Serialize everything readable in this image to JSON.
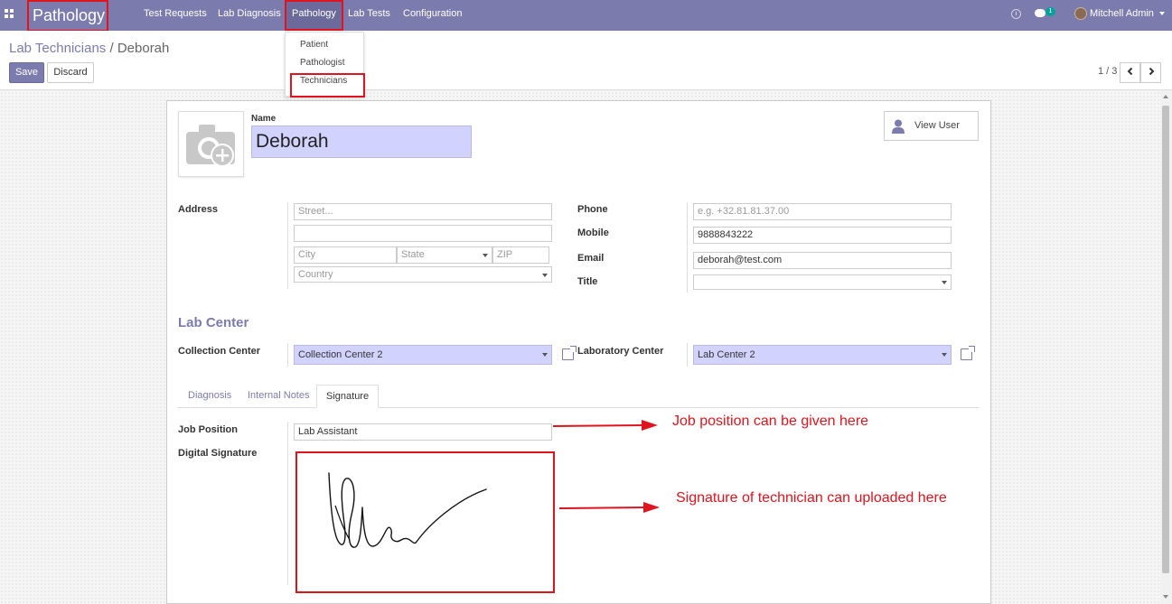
{
  "navbar": {
    "brand": "Pathology",
    "menu": [
      {
        "label": "Test Requests"
      },
      {
        "label": "Lab Diagnosis"
      },
      {
        "label": "Pathology"
      },
      {
        "label": "Lab Tests"
      },
      {
        "label": "Configuration"
      }
    ],
    "chat_count": "1",
    "user_name": "Mitchell Admin"
  },
  "dropdown": {
    "items": [
      "Patient",
      "Pathologist",
      "Technicians"
    ]
  },
  "control_panel": {
    "breadcrumb_parent": "Lab Technicians",
    "breadcrumb_separator": " / ",
    "breadcrumb_current": "Deborah",
    "save_label": "Save",
    "discard_label": "Discard",
    "pager_value": "1 / 3"
  },
  "form": {
    "name_label": "Name",
    "name_value": "Deborah",
    "view_user_label": "View User",
    "address_label": "Address",
    "street_placeholder": "Street...",
    "street2_value": "",
    "city_placeholder": "City",
    "state_placeholder": "State",
    "zip_placeholder": "ZIP",
    "country_placeholder": "Country",
    "phone_label": "Phone",
    "phone_placeholder": "e.g. +32.81.81.37.00",
    "mobile_label": "Mobile",
    "mobile_value": "9888843222",
    "email_label": "Email",
    "email_value": "deborah@test.com",
    "title_label": "Title",
    "title_value": "",
    "lab_center_title": "Lab Center",
    "collection_center_label": "Collection Center",
    "collection_center_value": "Collection Center 2",
    "laboratory_center_label": "Laboratory Center",
    "laboratory_center_value": "Lab Center 2",
    "tabs": [
      {
        "label": "Diagnosis"
      },
      {
        "label": "Internal Notes"
      },
      {
        "label": "Signature"
      }
    ],
    "job_position_label": "Job Position",
    "job_position_value": "Lab Assistant",
    "digital_signature_label": "Digital Signature"
  },
  "annotations": {
    "job_position_note": "Job position can be given here",
    "signature_note": "Signature of technician can uploaded here"
  },
  "colors": {
    "navbar": "#7c7bad",
    "highlight": "#e0141e",
    "required_field": "#d2d2ff"
  }
}
